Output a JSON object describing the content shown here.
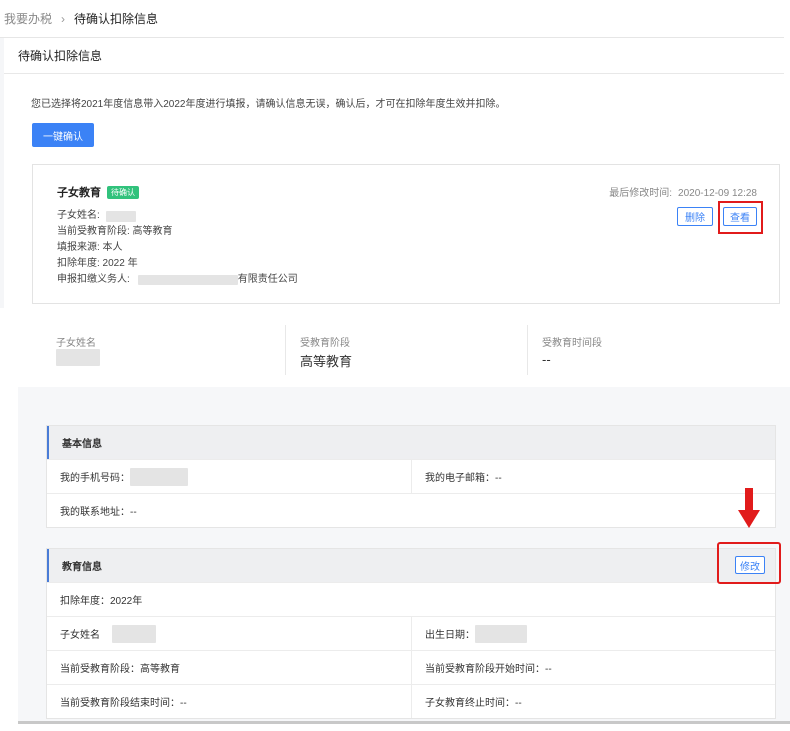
{
  "breadcrumb": {
    "parent": "我要办税",
    "separator": "›",
    "current": "待确认扣除信息"
  },
  "panel": {
    "title": "待确认扣除信息"
  },
  "notice": "您已选择将2021年度信息带入2022年度进行填报，请确认信息无误，确认后，才可在扣除年度生效并扣除。",
  "confirm_all_button": "一键确认",
  "card": {
    "title": "子女教育",
    "badge": "待确认",
    "modified_label": "最后修改时间:",
    "modified_value": "2020-12-09 12:28",
    "child_name_label": "子女姓名:",
    "stage_line": "当前受教育阶段: 高等教育",
    "source_line": "填报来源:  本人",
    "year_line": "扣除年度:  2022 年",
    "withholder_label": "申报扣缴义务人:",
    "withholder_suffix": "有限责任公司",
    "delete_button": "删除",
    "view_button": "查看"
  },
  "summary": {
    "name_label": "子女姓名",
    "stage_label": "受教育阶段",
    "stage_value": "高等教育",
    "period_label": "受教育时间段",
    "period_value": "--"
  },
  "basic_info": {
    "title": "基本信息",
    "phone_label": "我的手机号码：",
    "email_label": "我的电子邮箱：--",
    "address_label": "我的联系地址：--"
  },
  "edu_info": {
    "title": "教育信息",
    "edit_button": "修改",
    "year": "扣除年度：2022年",
    "child_name_label": "子女姓名",
    "birth_label": "出生日期：",
    "stage": "当前受教育阶段：高等教育",
    "stage_start": "当前受教育阶段开始时间：--",
    "stage_end": "当前受教育阶段结束时间：--",
    "edu_end": "子女教育终止时间：--"
  },
  "colors": {
    "primary": "#3b82f6",
    "badge_green": "#31c27c",
    "highlight_red": "#e11b1b",
    "section_accent": "#4a7cd7"
  }
}
